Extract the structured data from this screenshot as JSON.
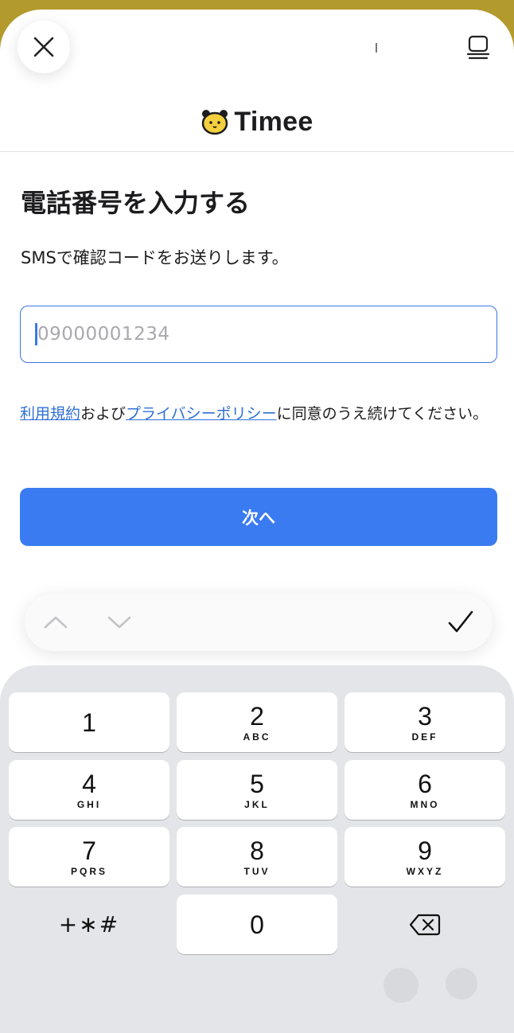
{
  "app": {
    "brand": "Timee",
    "brand_color": "#b39a2c",
    "accent": "#3a7bf2"
  },
  "header": {
    "close_icon": "close-icon",
    "menu_icon": "book-icon"
  },
  "content": {
    "title": "電話番号を入力する",
    "subtitle": "SMSで確認コードをお送りします。",
    "phone_input": {
      "placeholder": "09000001234",
      "value": ""
    },
    "terms": {
      "link_terms": "利用規約",
      "and": "および",
      "link_privacy": "プライバシーポリシー",
      "rest": "に同意のうえ続けてください。"
    },
    "next_button": "次へ"
  },
  "accessory_bar": {
    "up_icon": "chevron-up-icon",
    "down_icon": "chevron-down-icon",
    "done_icon": "checkmark-icon"
  },
  "keypad": {
    "keys": [
      {
        "digit": "1",
        "letters": ""
      },
      {
        "digit": "2",
        "letters": "ABC"
      },
      {
        "digit": "3",
        "letters": "DEF"
      },
      {
        "digit": "4",
        "letters": "GHI"
      },
      {
        "digit": "5",
        "letters": "JKL"
      },
      {
        "digit": "6",
        "letters": "MNO"
      },
      {
        "digit": "7",
        "letters": "PQRS"
      },
      {
        "digit": "8",
        "letters": "TUV"
      },
      {
        "digit": "9",
        "letters": "WXYZ"
      },
      {
        "digit": "0",
        "letters": ""
      }
    ],
    "symbols": "+∗#",
    "delete_icon": "backspace-icon"
  }
}
